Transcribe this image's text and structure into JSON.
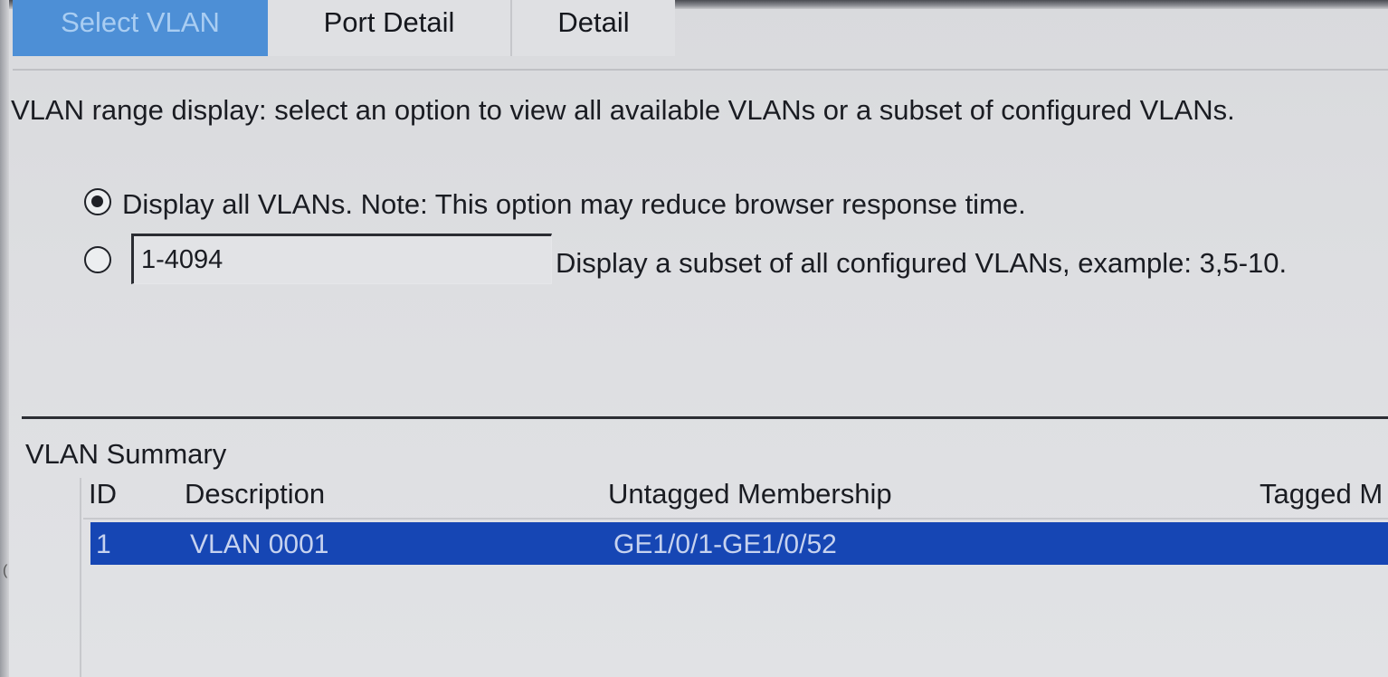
{
  "tabs": [
    {
      "label": "Select VLAN",
      "active": true
    },
    {
      "label": "Port Detail",
      "active": false
    },
    {
      "label": "Detail",
      "active": false
    }
  ],
  "intro_text": "VLAN range display: select an option to view all available VLANs or a subset of configured VLANs.",
  "options": {
    "display_all_label": "Display all VLANs. Note: This option may reduce browser response time.",
    "display_all_selected": true,
    "subset_value": "1-4094",
    "subset_label": "Display a subset of all configured VLANs, example: 3,5-10.",
    "subset_selected": false
  },
  "summary": {
    "title": "VLAN Summary",
    "columns": [
      "ID",
      "Description",
      "Untagged Membership",
      "Tagged M"
    ],
    "rows": [
      {
        "id": "1",
        "description": "VLAN 0001",
        "untagged": "GE1/0/1-GE1/0/52",
        "tagged": "",
        "selected": true
      }
    ]
  },
  "colors": {
    "active_tab": "#4d8fd6",
    "selected_row": "#1646b4",
    "background": "#dcdde0"
  }
}
